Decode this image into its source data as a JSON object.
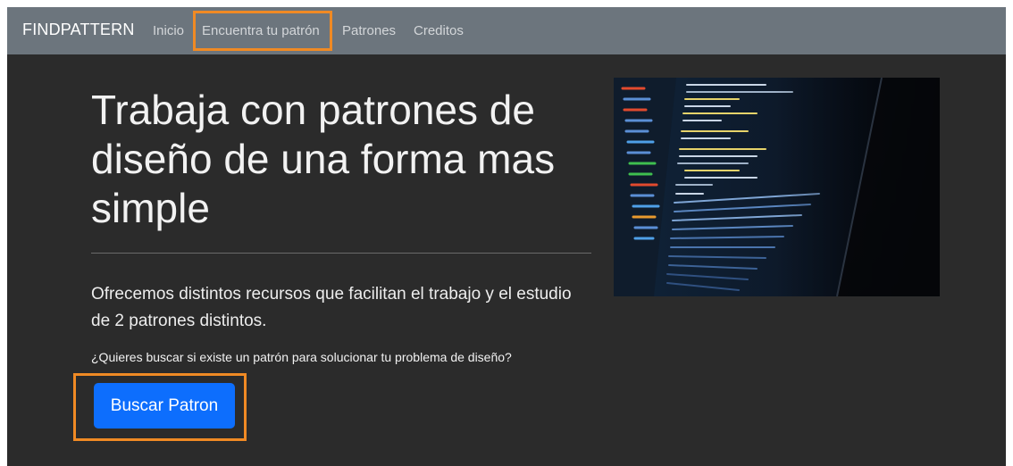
{
  "navbar": {
    "brand": "FINDPATTERN",
    "links": [
      {
        "label": "Inicio"
      },
      {
        "label": "Encuentra tu patrón"
      },
      {
        "label": "Patrones"
      },
      {
        "label": "Creditos"
      }
    ]
  },
  "hero": {
    "title": "Trabaja con patrones de diseño de una forma mas simple",
    "lead": "Ofrecemos distintos recursos que facilitan el trabajo y el estudio de 2 patrones distintos.",
    "question": "¿Quieres buscar si existe un patrón para solucionar tu problema de diseño?",
    "button_label": "Buscar Patron"
  },
  "colors": {
    "navbar_bg": "#6c757d",
    "page_bg": "#2b2b2b",
    "primary": "#0d6efd",
    "highlight": "#f08a24"
  },
  "icons": {
    "hero_image": "code-editor-photo"
  }
}
